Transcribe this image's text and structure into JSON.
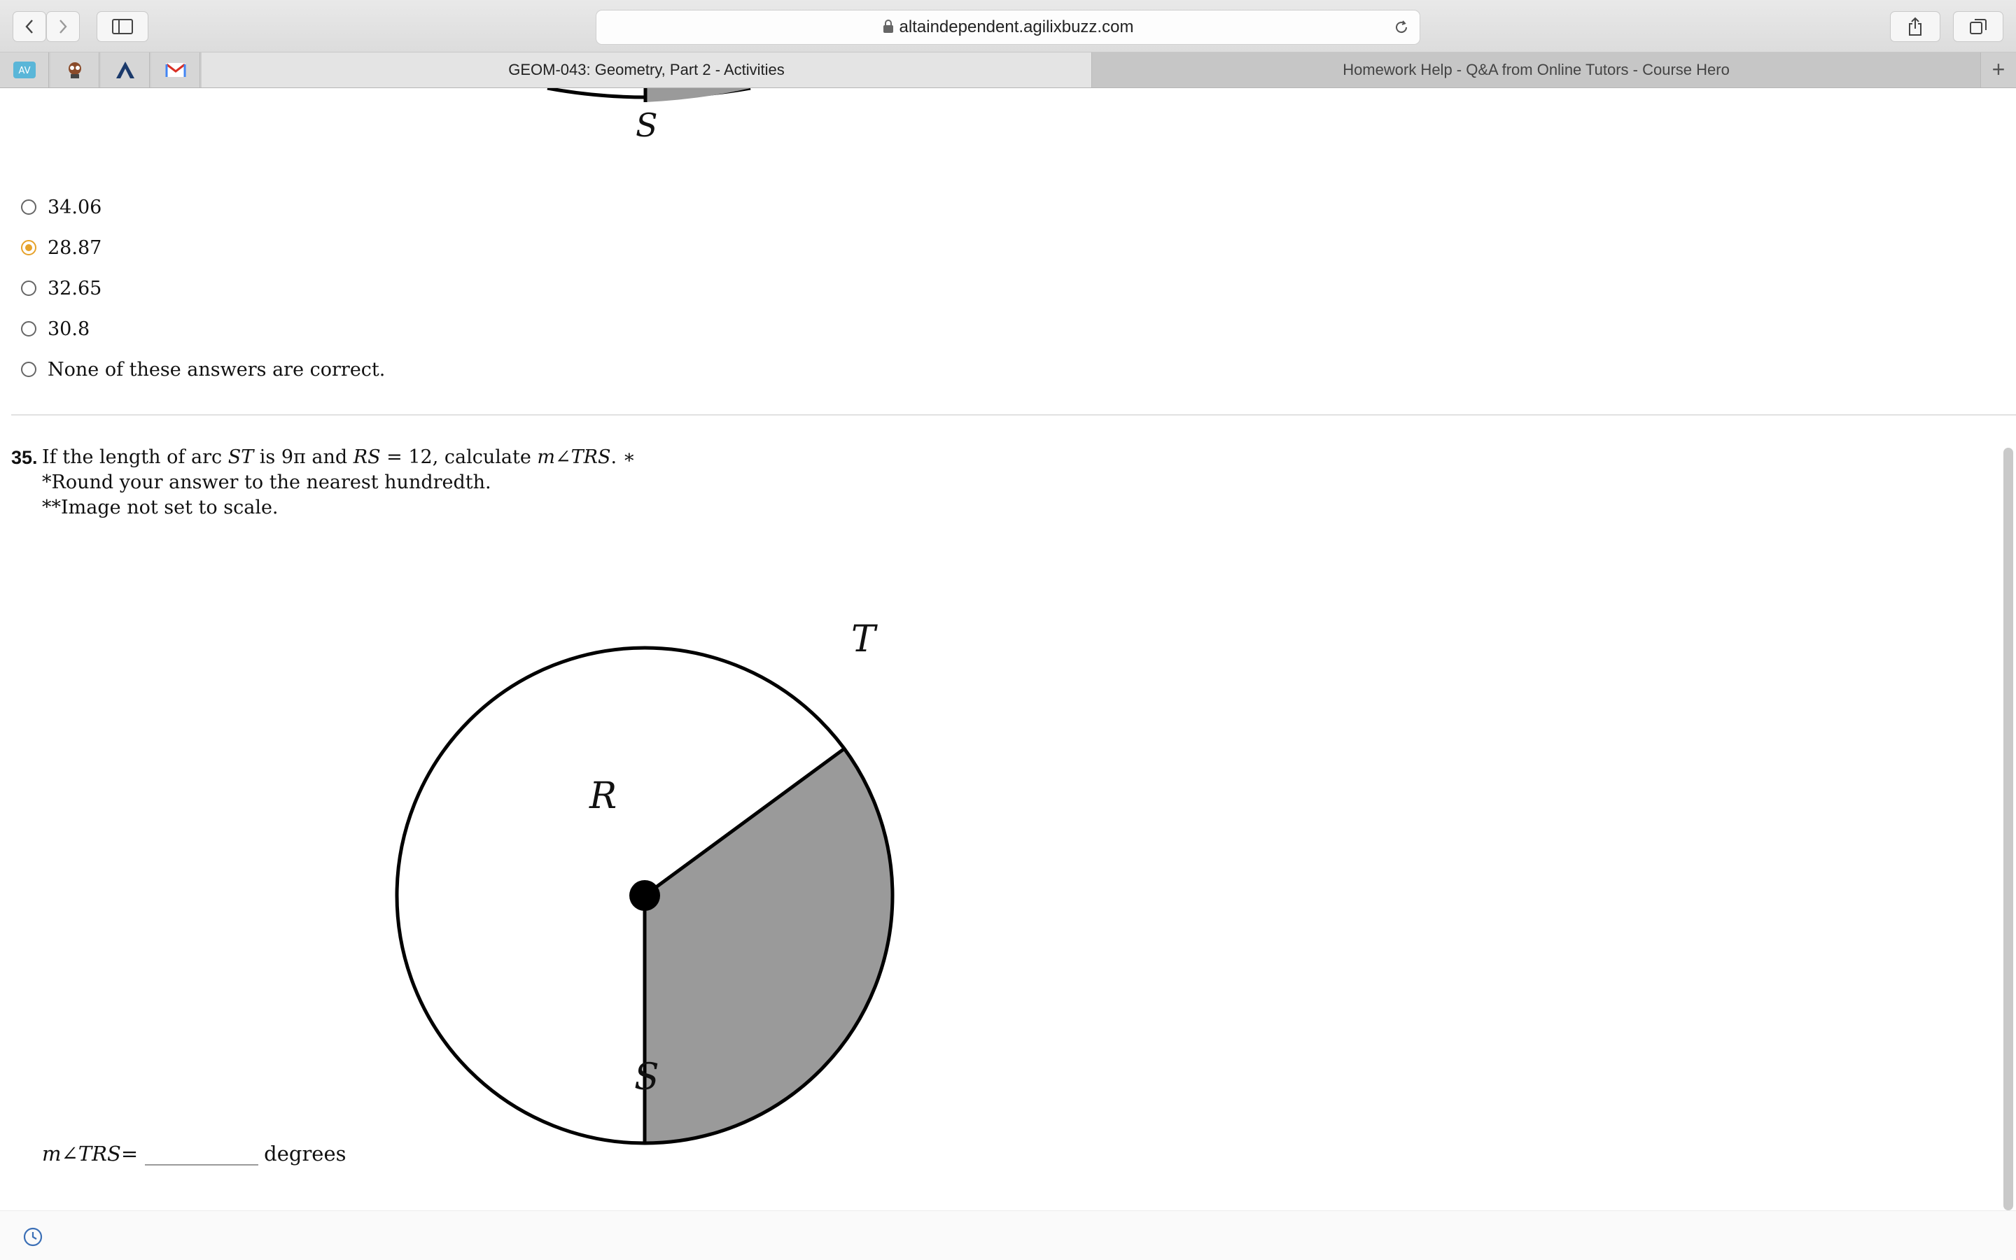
{
  "browser": {
    "url": "altaindependent.agilixbuzz.com",
    "tabs": [
      {
        "title": "GEOM-043: Geometry, Part 2 - Activities",
        "active": true
      },
      {
        "title": "Homework Help - Q&A from Online Tutors - Course Hero",
        "active": false
      }
    ],
    "new_tab_label": "+"
  },
  "previous_question": {
    "figure_label_bottom": "S",
    "options": [
      {
        "label": "34.06",
        "selected": false
      },
      {
        "label": "28.87",
        "selected": true
      },
      {
        "label": "32.65",
        "selected": false
      },
      {
        "label": "30.8",
        "selected": false
      },
      {
        "label": "None of these answers are correct.",
        "selected": false
      }
    ]
  },
  "question": {
    "number": "35.",
    "text": {
      "p1": "If the length of arc ",
      "m1": "ST",
      "p2": " is 9π and ",
      "m2": "RS",
      "p3": " = 12, calculate ",
      "m3": "m∠TRS",
      "p4": ". ∗"
    },
    "note1": "*Round your answer to the nearest hundredth.",
    "note2": "**Image not set to scale.",
    "figure": {
      "label_t": "T",
      "label_r": "R",
      "label_s": "S"
    },
    "answer": {
      "lhs": "m∠TRS",
      "equals": " =",
      "value": "",
      "unit": "degrees"
    }
  },
  "colors": {
    "selected_radio": "#e6a22a",
    "sector_fill": "#9a9a9a"
  }
}
